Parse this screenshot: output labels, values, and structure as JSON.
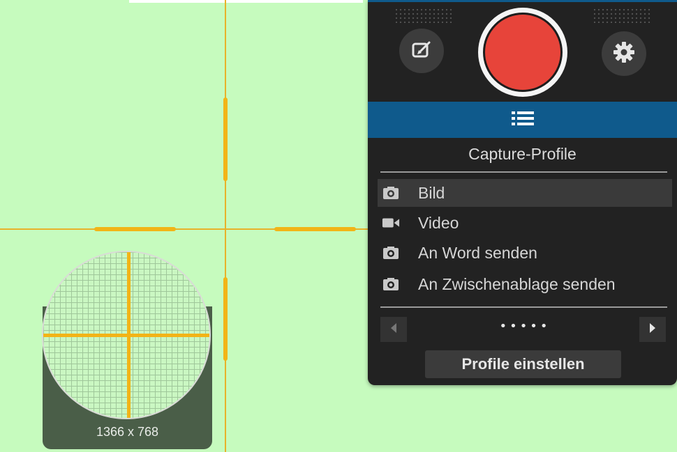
{
  "magnifier": {
    "dimensions": "1366 x 768"
  },
  "panel": {
    "title": "Capture-Profile",
    "items": [
      {
        "label": "Bild",
        "icon": "camera-icon",
        "active": true
      },
      {
        "label": "Video",
        "icon": "video-camera-icon",
        "active": false
      },
      {
        "label": "An Word senden",
        "icon": "camera-icon",
        "active": false
      },
      {
        "label": "An Zwischenablage senden",
        "icon": "camera-icon",
        "active": false
      }
    ],
    "pager_dots": "•••••",
    "settings_button": "Profile einstellen"
  },
  "colors": {
    "background": "#c6fbbe",
    "crosshair": "#f2b417",
    "record": "#e7443a",
    "accent": "#0f5a8c",
    "panel": "#222222"
  }
}
